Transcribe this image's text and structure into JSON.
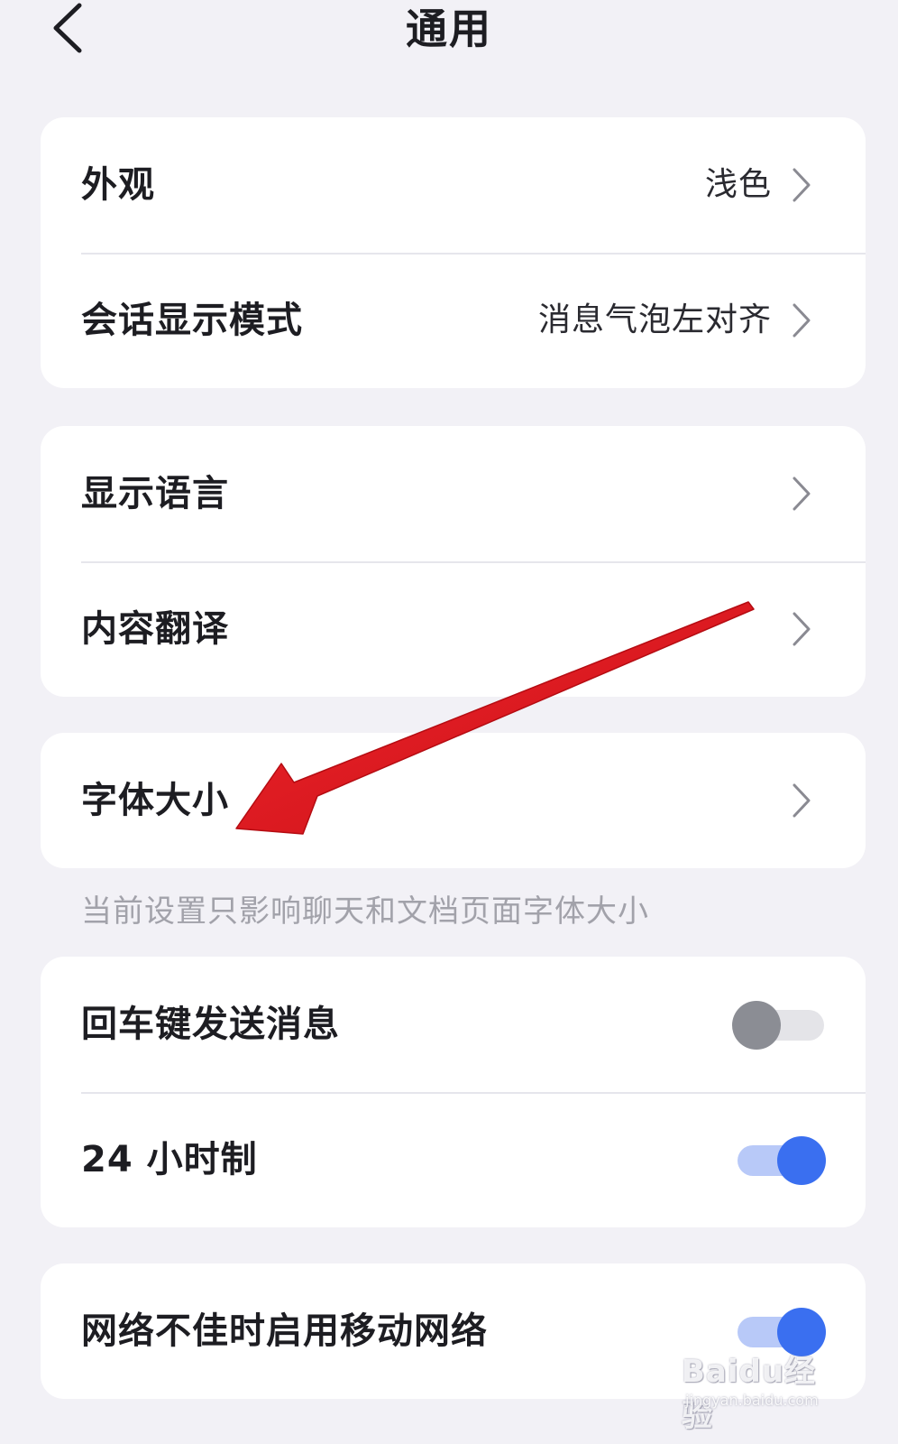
{
  "header": {
    "title": "通用"
  },
  "sections": {
    "display": {
      "appearance": {
        "label": "外观",
        "value": "浅色"
      },
      "chat_mode": {
        "label": "会话显示模式",
        "value": "消息气泡左对齐"
      }
    },
    "language": {
      "display_language": {
        "label": "显示语言"
      },
      "translation": {
        "label": "内容翻译"
      }
    },
    "font": {
      "font_size": {
        "label": "字体大小"
      },
      "hint": "当前设置只影响聊天和文档页面字体大小"
    },
    "toggles": {
      "enter_send": {
        "label": "回车键发送消息",
        "on": false
      },
      "clock_24h": {
        "label": "24 小时制",
        "on": true
      }
    },
    "network": {
      "mobile_fallback": {
        "label": "网络不佳时启用移动网络",
        "on": true
      }
    }
  },
  "annotation": {
    "arrow_color": "#e3141c"
  },
  "watermark": {
    "logo": "Baidu经验",
    "url": "jingyan.baidu.com"
  },
  "colors": {
    "accent": "#3a6ff0",
    "background": "#f2f1f6",
    "card": "#ffffff"
  }
}
